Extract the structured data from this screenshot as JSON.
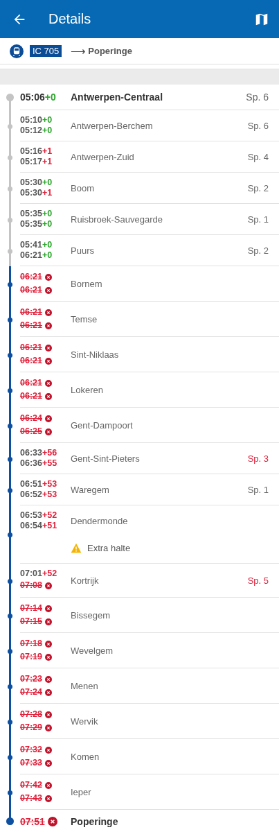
{
  "app_bar": {
    "title": "Details"
  },
  "train": {
    "number": "IC 705",
    "arrow": "⟶",
    "destination": "Poperinge"
  },
  "stops": [
    {
      "kind": "origin",
      "name": "Antwerpen-Centraal",
      "platform": "Sp. 6",
      "platform_changed": false,
      "passed": true,
      "times": [
        {
          "time": "05:06",
          "delay": "+0",
          "late": false,
          "cancelled": false
        }
      ]
    },
    {
      "kind": "stop",
      "name": "Antwerpen-Berchem",
      "platform": "Sp. 6",
      "platform_changed": false,
      "passed": true,
      "times": [
        {
          "time": "05:10",
          "delay": "+0",
          "late": false,
          "cancelled": false
        },
        {
          "time": "05:12",
          "delay": "+0",
          "late": false,
          "cancelled": false
        }
      ]
    },
    {
      "kind": "stop",
      "name": "Antwerpen-Zuid",
      "platform": "Sp. 4",
      "platform_changed": false,
      "passed": true,
      "times": [
        {
          "time": "05:16",
          "delay": "+1",
          "late": true,
          "cancelled": false
        },
        {
          "time": "05:17",
          "delay": "+1",
          "late": true,
          "cancelled": false
        }
      ]
    },
    {
      "kind": "stop",
      "name": "Boom",
      "platform": "Sp. 2",
      "platform_changed": false,
      "passed": true,
      "times": [
        {
          "time": "05:30",
          "delay": "+0",
          "late": false,
          "cancelled": false
        },
        {
          "time": "05:30",
          "delay": "+1",
          "late": true,
          "cancelled": false
        }
      ]
    },
    {
      "kind": "stop",
      "name": "Ruisbroek-Sauvegarde",
      "platform": "Sp. 1",
      "platform_changed": false,
      "passed": true,
      "times": [
        {
          "time": "05:35",
          "delay": "+0",
          "late": false,
          "cancelled": false
        },
        {
          "time": "05:35",
          "delay": "+0",
          "late": false,
          "cancelled": false
        }
      ]
    },
    {
      "kind": "stop",
      "name": "Puurs",
      "platform": "Sp. 2",
      "platform_changed": false,
      "passed": true,
      "times": [
        {
          "time": "05:41",
          "delay": "+0",
          "late": false,
          "cancelled": false
        },
        {
          "time": "06:21",
          "delay": "+0",
          "late": false,
          "cancelled": false
        }
      ]
    },
    {
      "kind": "stop",
      "name": "Bornem",
      "passed": false,
      "times": [
        {
          "time": "06:21",
          "cancelled": true
        },
        {
          "time": "06:21",
          "cancelled": true
        }
      ]
    },
    {
      "kind": "stop",
      "name": "Temse",
      "passed": false,
      "times": [
        {
          "time": "06:21",
          "cancelled": true
        },
        {
          "time": "06:21",
          "cancelled": true
        }
      ]
    },
    {
      "kind": "stop",
      "name": "Sint-Niklaas",
      "passed": false,
      "times": [
        {
          "time": "06:21",
          "cancelled": true
        },
        {
          "time": "06:21",
          "cancelled": true
        }
      ]
    },
    {
      "kind": "stop",
      "name": "Lokeren",
      "passed": false,
      "times": [
        {
          "time": "06:21",
          "cancelled": true
        },
        {
          "time": "06:21",
          "cancelled": true
        }
      ]
    },
    {
      "kind": "stop",
      "name": "Gent-Dampoort",
      "passed": false,
      "times": [
        {
          "time": "06:24",
          "cancelled": true
        },
        {
          "time": "06:25",
          "cancelled": true
        }
      ]
    },
    {
      "kind": "stop",
      "name": "Gent-Sint-Pieters",
      "platform": "Sp. 3",
      "platform_changed": true,
      "passed": false,
      "times": [
        {
          "time": "06:33",
          "delay": "+56",
          "late": true,
          "cancelled": false
        },
        {
          "time": "06:36",
          "delay": "+55",
          "late": true,
          "cancelled": false
        }
      ]
    },
    {
      "kind": "stop",
      "name": "Waregem",
      "platform": "Sp. 1",
      "platform_changed": false,
      "passed": false,
      "times": [
        {
          "time": "06:51",
          "delay": "+53",
          "late": true,
          "cancelled": false
        },
        {
          "time": "06:52",
          "delay": "+53",
          "late": true,
          "cancelled": false
        }
      ]
    },
    {
      "kind": "stop",
      "name": "Dendermonde",
      "passed": false,
      "note": "Extra halte",
      "times": [
        {
          "time": "06:53",
          "delay": "+52",
          "late": true,
          "cancelled": false
        },
        {
          "time": "06:54",
          "delay": "+51",
          "late": true,
          "cancelled": false
        }
      ]
    },
    {
      "kind": "stop",
      "name": "Kortrijk",
      "platform": "Sp. 5",
      "platform_changed": true,
      "passed": false,
      "times": [
        {
          "time": "07:01",
          "delay": "+52",
          "late": true,
          "cancelled": false
        },
        {
          "time": "07:08",
          "cancelled": true
        }
      ]
    },
    {
      "kind": "stop",
      "name": "Bissegem",
      "passed": false,
      "times": [
        {
          "time": "07:14",
          "cancelled": true
        },
        {
          "time": "07:15",
          "cancelled": true
        }
      ]
    },
    {
      "kind": "stop",
      "name": "Wevelgem",
      "passed": false,
      "times": [
        {
          "time": "07:18",
          "cancelled": true
        },
        {
          "time": "07:19",
          "cancelled": true
        }
      ]
    },
    {
      "kind": "stop",
      "name": "Menen",
      "passed": false,
      "times": [
        {
          "time": "07:23",
          "cancelled": true
        },
        {
          "time": "07:24",
          "cancelled": true
        }
      ]
    },
    {
      "kind": "stop",
      "name": "Wervik",
      "passed": false,
      "times": [
        {
          "time": "07:28",
          "cancelled": true
        },
        {
          "time": "07:29",
          "cancelled": true
        }
      ]
    },
    {
      "kind": "stop",
      "name": "Komen",
      "passed": false,
      "times": [
        {
          "time": "07:32",
          "cancelled": true
        },
        {
          "time": "07:33",
          "cancelled": true
        }
      ]
    },
    {
      "kind": "stop",
      "name": "Ieper",
      "passed": false,
      "times": [
        {
          "time": "07:42",
          "cancelled": true
        },
        {
          "time": "07:43",
          "cancelled": true
        }
      ]
    },
    {
      "kind": "destination",
      "name": "Poperinge",
      "passed": false,
      "times": [
        {
          "time": "07:51",
          "cancelled": true
        }
      ]
    }
  ]
}
